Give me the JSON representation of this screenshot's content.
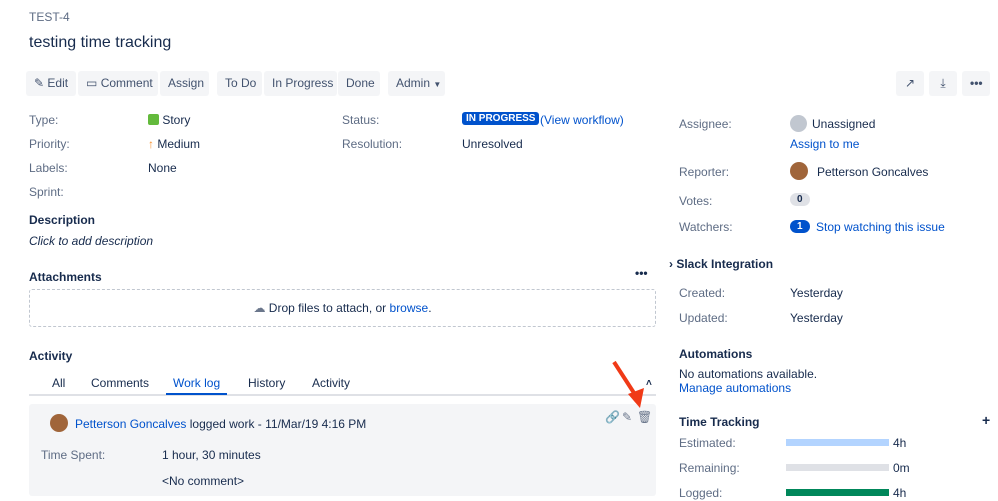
{
  "issue_key": "TEST-4",
  "title": "testing time tracking",
  "toolbar": {
    "edit": "Edit",
    "comment": "Comment",
    "assign": "Assign",
    "todo": "To Do",
    "inprogress": "In Progress",
    "done": "Done",
    "admin": "Admin"
  },
  "fields": {
    "type_label": "Type:",
    "type": "Story",
    "priority_label": "Priority:",
    "priority": "Medium",
    "labels_label": "Labels:",
    "labels": "None",
    "sprint_label": "Sprint:",
    "status_label": "Status:",
    "status": "IN PROGRESS",
    "view_workflow": "(View workflow)",
    "resolution_label": "Resolution:",
    "resolution": "Unresolved"
  },
  "description": {
    "heading": "Description",
    "placeholder": "Click to add description"
  },
  "attachments": {
    "heading": "Attachments",
    "drop_text": "Drop files to attach, or ",
    "browse": "browse",
    "period": "."
  },
  "activity": {
    "heading": "Activity",
    "tabs": [
      "All",
      "Comments",
      "Work log",
      "History",
      "Activity"
    ],
    "active_tab": "Work log",
    "entry": {
      "author": "Petterson Goncalves",
      "text": "logged work - 11/Mar/19 4:16 PM",
      "time_label": "Time Spent:",
      "time": "1 hour, 30 minutes",
      "comment": "<No comment>"
    }
  },
  "people": {
    "assignee_label": "Assignee:",
    "assignee": "Unassigned",
    "assign_to_me": "Assign to me",
    "reporter_label": "Reporter:",
    "reporter": "Petterson Goncalves",
    "votes_label": "Votes:",
    "votes": "0",
    "watchers_label": "Watchers:",
    "watchers": "1",
    "stop_watching": "Stop watching this issue"
  },
  "slack": {
    "heading": "Slack Integration"
  },
  "dates": {
    "created_label": "Created:",
    "created": "Yesterday",
    "updated_label": "Updated:",
    "updated": "Yesterday"
  },
  "automations": {
    "heading": "Automations",
    "none": "No automations available.",
    "manage": "Manage automations"
  },
  "time_tracking": {
    "heading": "Time Tracking",
    "estimated_label": "Estimated:",
    "estimated": "4h",
    "remaining_label": "Remaining:",
    "remaining": "0m",
    "logged_label": "Logged:",
    "logged": "4h",
    "estimated_fraction": 1,
    "remaining_fraction": 0,
    "logged_fraction": 1
  },
  "colors": {
    "estimated": "#b3d4ff",
    "remaining": "#dfe1e6",
    "logged": "#00875a",
    "status": "#0052cc"
  }
}
